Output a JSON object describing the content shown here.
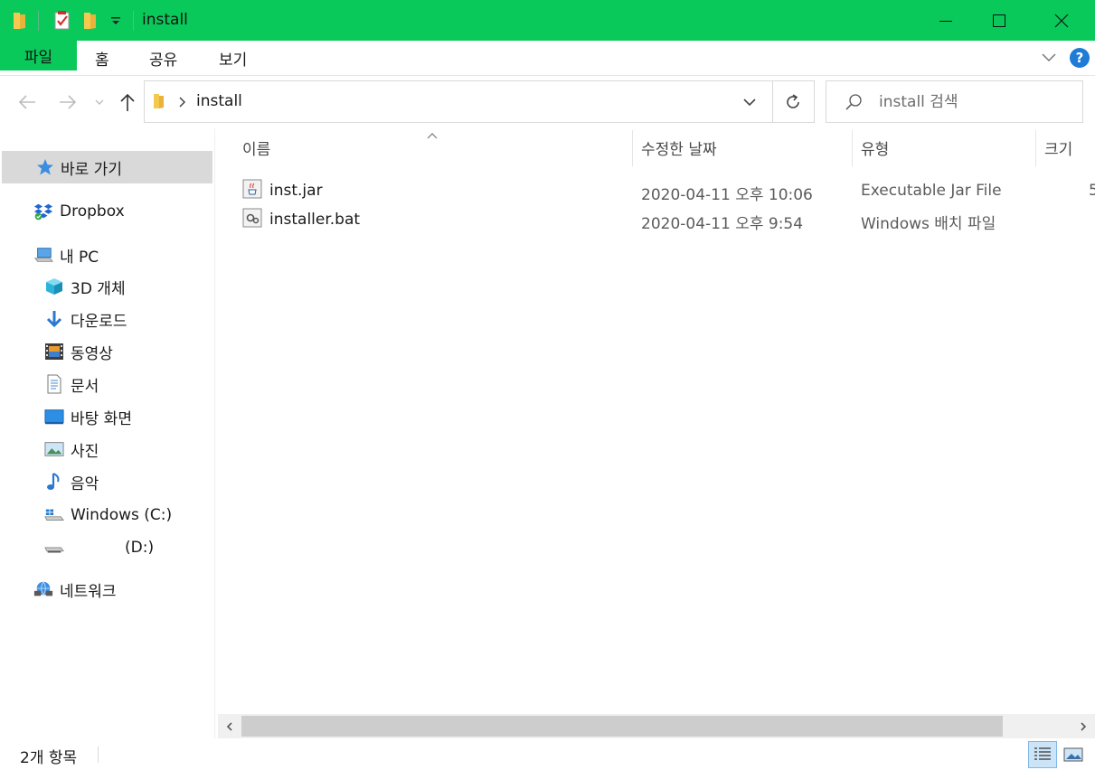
{
  "window": {
    "title": "install",
    "controls": {
      "minimize": "minimize",
      "maximize": "maximize",
      "close": "close"
    }
  },
  "ribbon": {
    "tabs": [
      {
        "label": "파일"
      },
      {
        "label": "홈"
      },
      {
        "label": "공유"
      },
      {
        "label": "보기"
      }
    ],
    "help_label": "?"
  },
  "navigation": {
    "address_path": "install",
    "search_placeholder": "install 검색"
  },
  "sidebar": {
    "items": [
      {
        "label": "바로 가기",
        "icon": "star-icon"
      },
      {
        "label": "Dropbox",
        "icon": "dropbox-icon"
      },
      {
        "label": "내 PC",
        "icon": "computer-icon"
      },
      {
        "label": "3D 개체",
        "icon": "cube-3d-icon"
      },
      {
        "label": "다운로드",
        "icon": "download-icon"
      },
      {
        "label": "동영상",
        "icon": "video-icon"
      },
      {
        "label": "문서",
        "icon": "document-icon"
      },
      {
        "label": "바탕 화면",
        "icon": "desktop-icon"
      },
      {
        "label": "사진",
        "icon": "pictures-icon"
      },
      {
        "label": "음악",
        "icon": "music-icon"
      },
      {
        "label": "Windows (C:)",
        "icon": "windows-drive-icon"
      },
      {
        "label": "(D:)",
        "icon": "drive-icon"
      },
      {
        "label": "네트워크",
        "icon": "network-icon"
      }
    ]
  },
  "file_list": {
    "columns": [
      {
        "label": "이름"
      },
      {
        "label": "수정한 날짜"
      },
      {
        "label": "유형"
      },
      {
        "label": "크기"
      }
    ],
    "rows": [
      {
        "name": "inst.jar",
        "modified": "2020-04-11 오후 10:06",
        "type": "Executable Jar File",
        "size": "5",
        "icon": "jar-file-icon"
      },
      {
        "name": "installer.bat",
        "modified": "2020-04-11 오후 9:54",
        "type": "Windows 배치 파일",
        "size": "",
        "icon": "batch-file-icon"
      }
    ]
  },
  "status": {
    "item_count": "2개 항목"
  },
  "colors": {
    "titlebar": "#0ac95b",
    "selection": "#d9d9d9",
    "accent": "#1e7bd6"
  }
}
